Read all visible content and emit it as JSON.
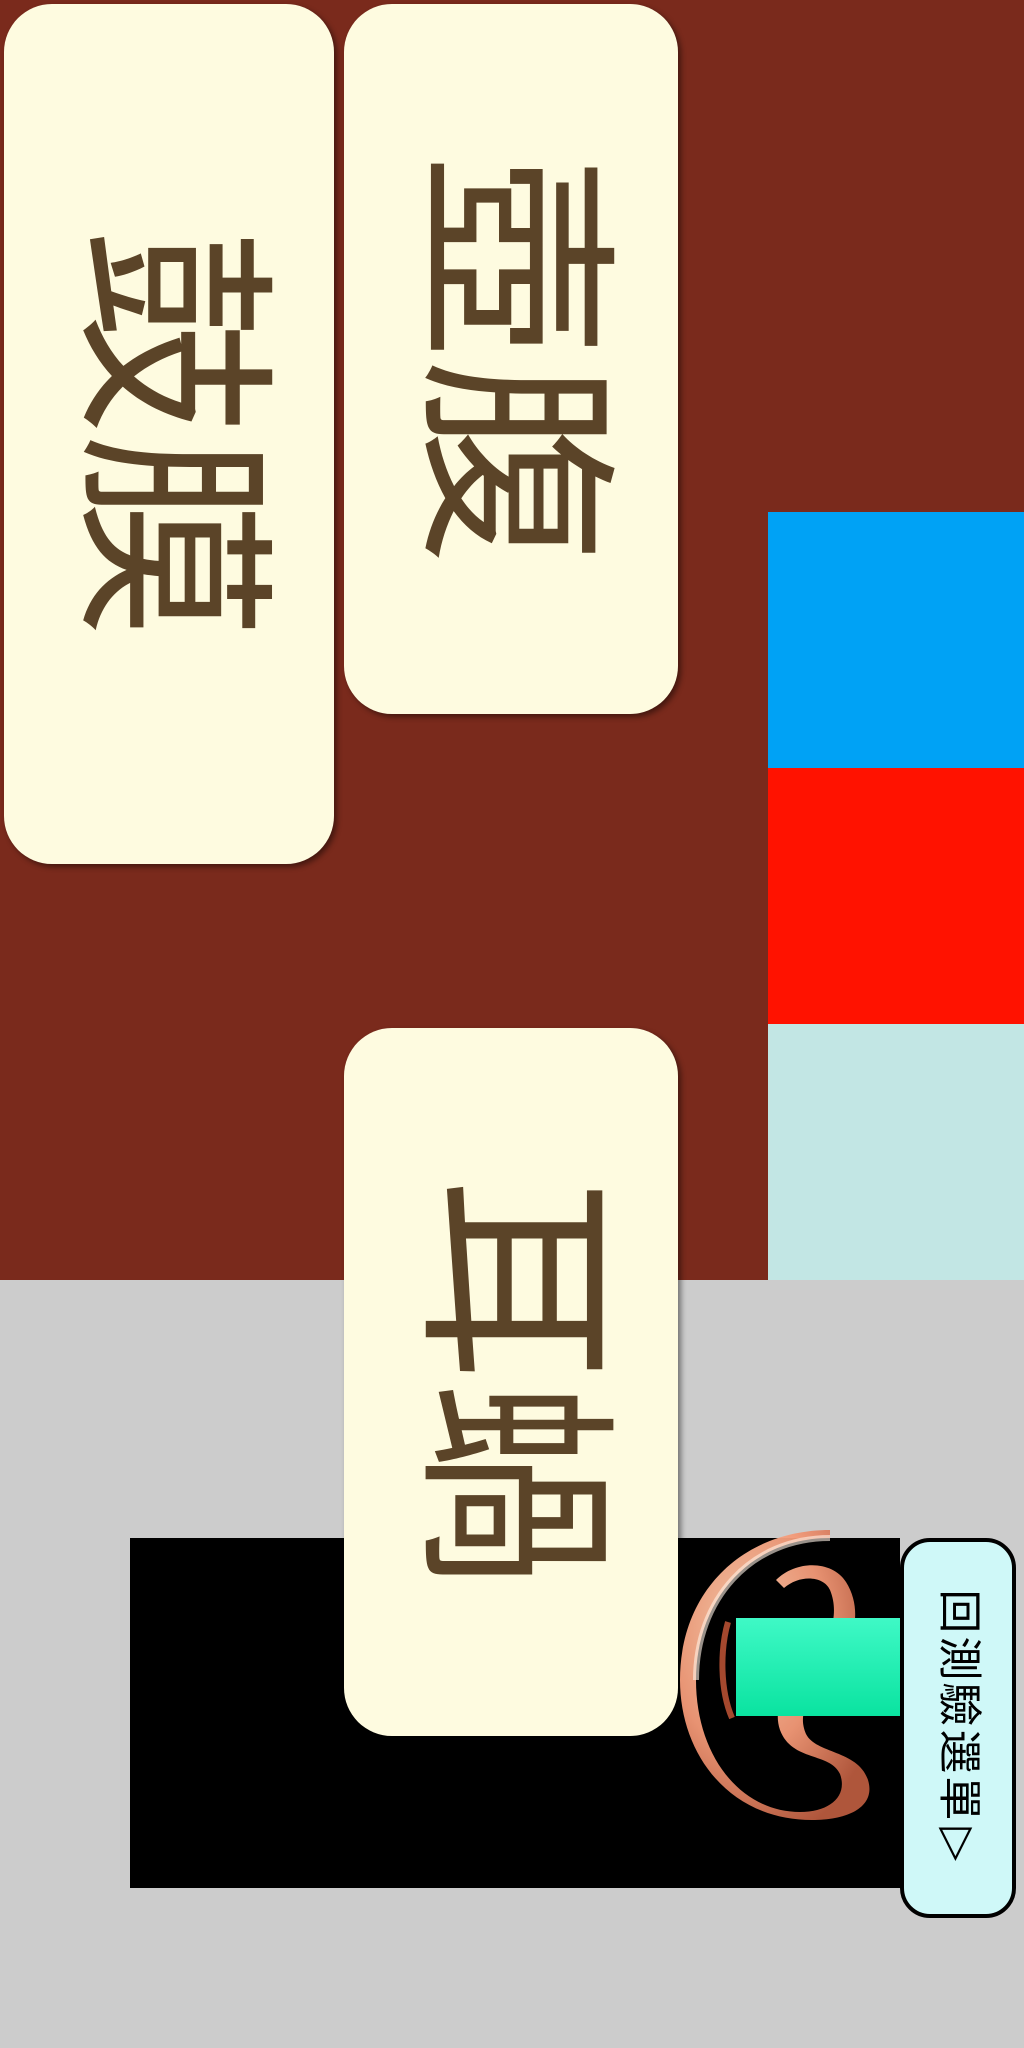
{
  "cards": {
    "gumowka": {
      "label": "鼓膜"
    },
    "hulu": {
      "label": "壺腹"
    },
    "ergu": {
      "label": "耳蝸"
    }
  },
  "menu_button": {
    "label": "回測驗選單▷"
  },
  "colors": {
    "background_brown": "#7a2a1c",
    "card_fill": "#fefbe0",
    "card_text": "#5b4428",
    "stripe_blue": "#00a2f5",
    "stripe_red": "#ff1200",
    "stripe_cyan": "#c2e6e4",
    "lower_gray": "#cccccc",
    "menu_button_fill": "#cff8f8",
    "ear_target": "#0ef5ae"
  },
  "icons": {
    "ear": "ear-icon"
  }
}
